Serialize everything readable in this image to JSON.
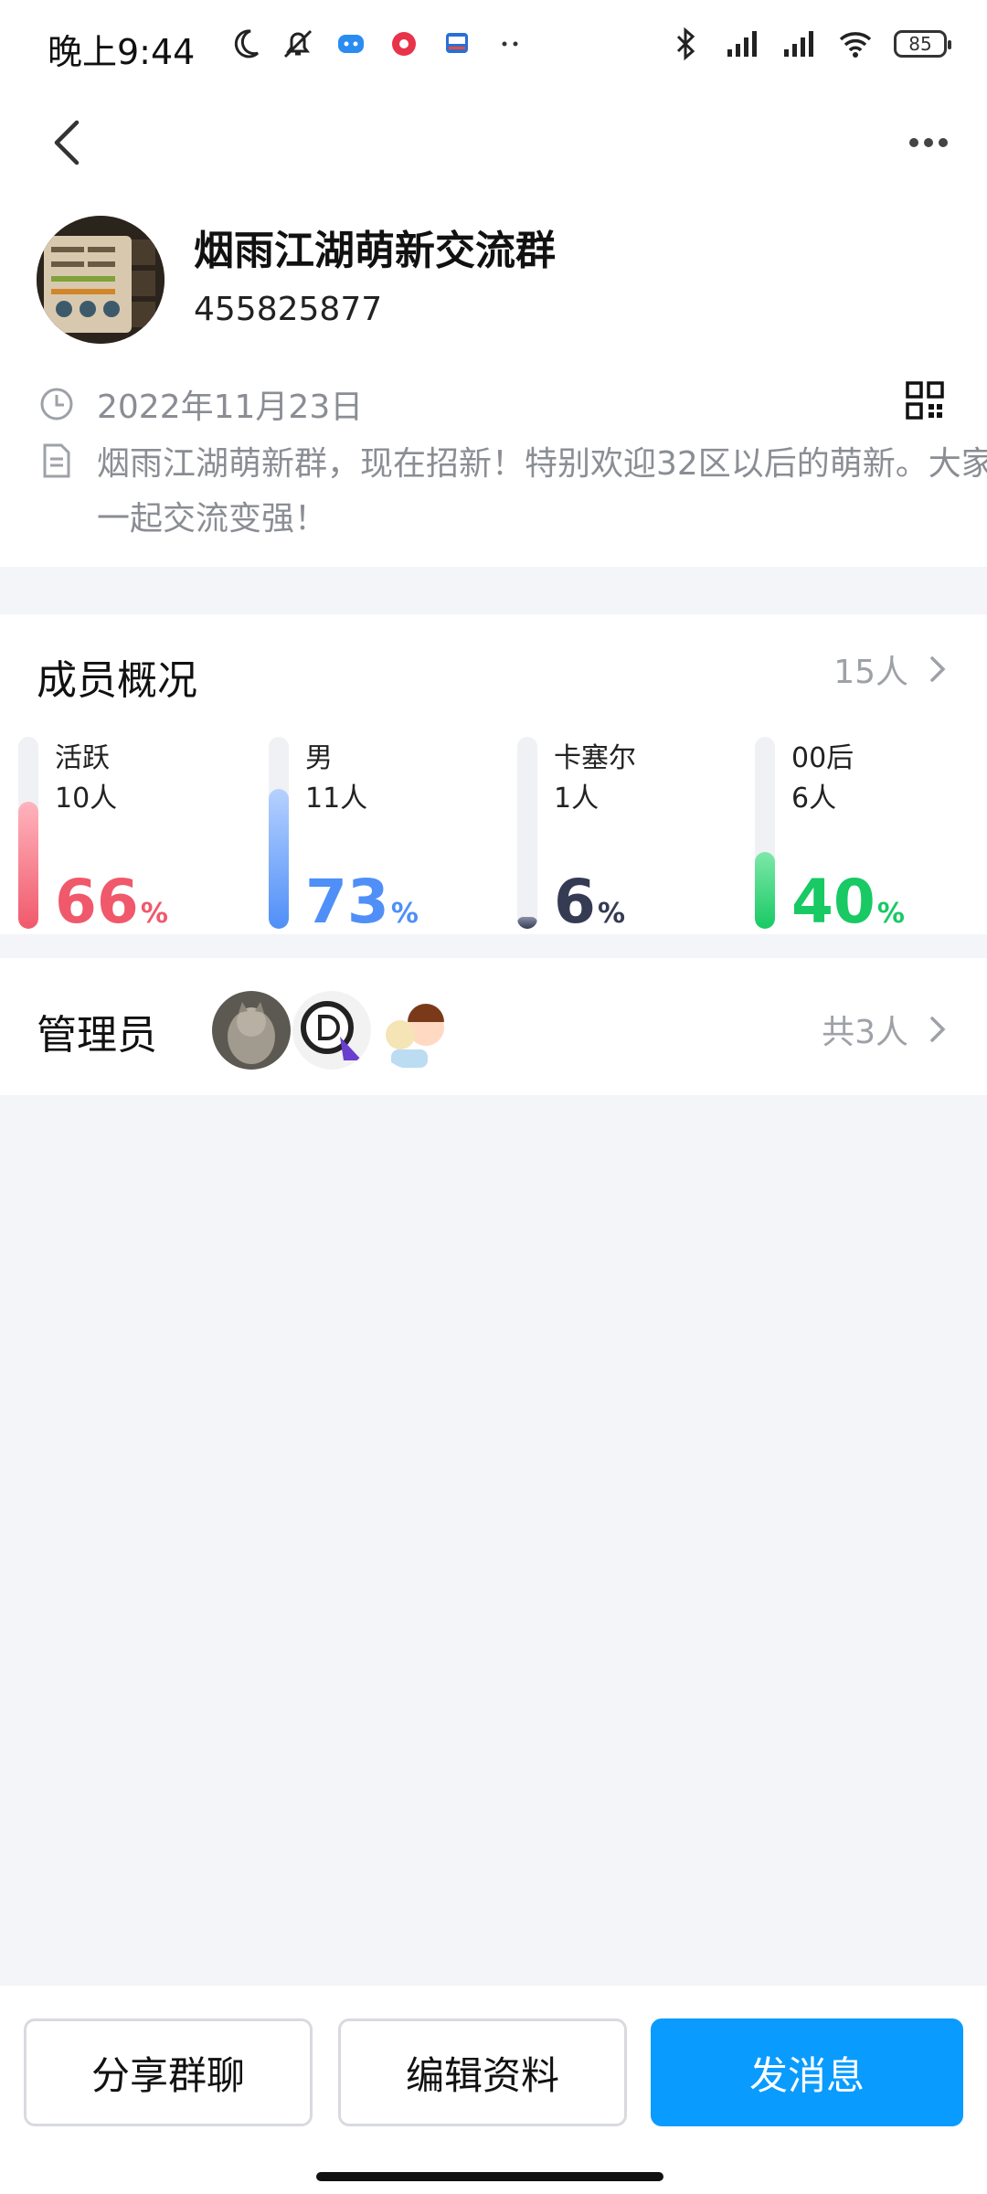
{
  "status_bar": {
    "time": "晚上9:44",
    "battery": "85"
  },
  "header": {
    "group_name": "烟雨江湖萌新交流群",
    "group_id": "455825877",
    "created_date": "2022年11月23日",
    "description": "烟雨江湖萌新群，现在招新！特别欢迎32区以后的萌新。大家一起交流变强！"
  },
  "members": {
    "title": "成员概况",
    "count_label": "15人",
    "stats": [
      {
        "label": "活跃",
        "count": "10人",
        "percent": 66,
        "percent_text": "66",
        "color": "#f0596b",
        "color_light": "#ffb4bd"
      },
      {
        "label": "男",
        "count": "11人",
        "percent": 73,
        "percent_text": "73",
        "color": "#4f8ff7",
        "color_light": "#b6d1ff"
      },
      {
        "label": "卡塞尔",
        "count": "1人",
        "percent": 6,
        "percent_text": "6",
        "color": "#363b54",
        "color_light": "#8a90a8"
      },
      {
        "label": "00后",
        "count": "6人",
        "percent": 40,
        "percent_text": "40",
        "color": "#18c964",
        "color_light": "#7ee8a8"
      }
    ],
    "percent_sign": "%"
  },
  "admins": {
    "title": "管理员",
    "count_label": "共3人"
  },
  "bottom_bar": {
    "share_label": "分享群聊",
    "edit_label": "编辑资料",
    "message_label": "发消息",
    "primary_color": "#0a9bff"
  },
  "icons": [
    "back-arrow-icon",
    "more-icon",
    "clock-icon",
    "document-icon",
    "qr-code-icon",
    "chevron-right-icon",
    "bluetooth-icon",
    "signal-icon",
    "wifi-icon",
    "battery-icon",
    "moon-icon",
    "mute-icon"
  ]
}
